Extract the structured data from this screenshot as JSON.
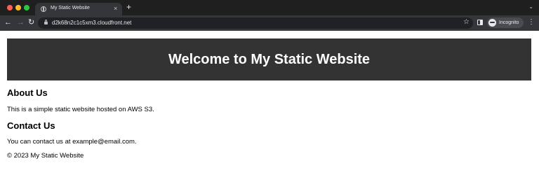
{
  "browser": {
    "tab": {
      "title": "My Static Website",
      "close_glyph": "×"
    },
    "new_tab_glyph": "+",
    "tab_list_glyph": "⌄",
    "nav": {
      "back": "←",
      "forward": "→",
      "reload": "↻"
    },
    "url": "d2k68n2c1c5xm3.cloudfront.net",
    "star_glyph": "☆",
    "incognito_label": "Incognito",
    "menu_glyph": "⋮",
    "icons": [
      "globe-icon",
      "lock-icon",
      "star-icon",
      "side-panel-icon",
      "incognito-icon",
      "kebab-menu-icon"
    ],
    "colors": {
      "traffic_red": "#ff5f57",
      "traffic_yellow": "#febc2e",
      "traffic_green": "#28c840"
    }
  },
  "page": {
    "header_title": "Welcome to My Static Website",
    "header_bg": "#333333",
    "about": {
      "heading": "About Us",
      "text": "This is a simple static website hosted on AWS S3."
    },
    "contact": {
      "heading": "Contact Us",
      "text": "You can contact us at example@email.com."
    },
    "footer": "© 2023 My Static Website"
  }
}
